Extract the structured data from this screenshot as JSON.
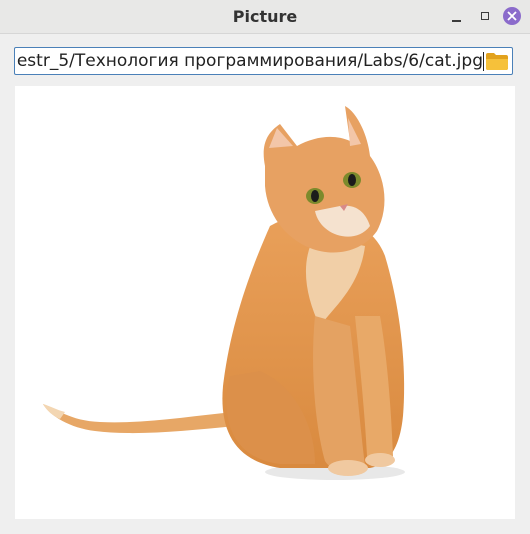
{
  "window": {
    "title": "Picture"
  },
  "path_field": {
    "value": "estr_5/Технология программирования/Labs/6/cat.jpg"
  },
  "icons": {
    "folder": "folder-open-icon",
    "minimize": "minimize-icon",
    "maximize": "maximize-icon",
    "close": "close-icon"
  },
  "colors": {
    "close_button": "#8b6bcb",
    "field_border": "#4a80b8",
    "folder": "#f3b82a"
  }
}
